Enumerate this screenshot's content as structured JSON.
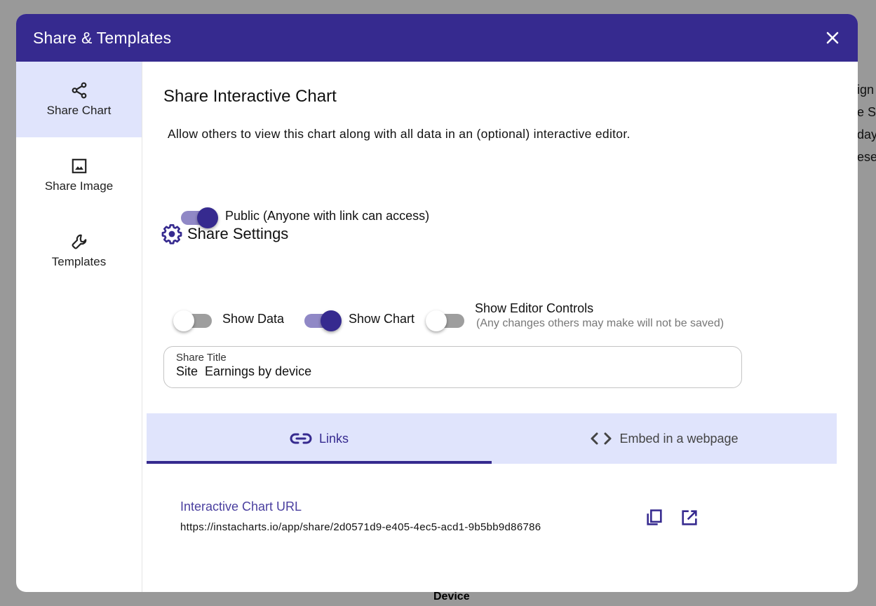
{
  "background": {
    "right_text_fragments": [
      "ign",
      "e S",
      "day",
      "ese"
    ],
    "footer_label": "Device"
  },
  "modal": {
    "title": "Share & Templates",
    "close_icon": "close-icon",
    "colors": {
      "primary": "#362a8f",
      "active_bg": "#e0e4fc",
      "switch_track_on": "#9088c6",
      "switch_track_off": "#9e9e9e"
    }
  },
  "sidebar": {
    "items": [
      {
        "label": "Share Chart",
        "icon": "share-icon",
        "active": true
      },
      {
        "label": "Share Image",
        "icon": "image-icon",
        "active": false
      },
      {
        "label": "Templates",
        "icon": "wrench-icon",
        "active": false
      }
    ]
  },
  "main": {
    "heading": "Share Interactive Chart",
    "description": "Allow others to view this chart along with all data in an (optional) interactive editor.",
    "public_toggle": {
      "label": "Public (Anyone with link can access)",
      "checked": true
    },
    "settings": {
      "heading": "Share Settings",
      "icon": "gear-icon",
      "toggles": [
        {
          "label": "Show Data",
          "checked": false
        },
        {
          "label": "Show Chart",
          "checked": true
        },
        {
          "label": "Show Editor Controls",
          "sublabel": "(Any changes others may make will not be saved)",
          "checked": false
        }
      ]
    },
    "share_title": {
      "label": "Share Title",
      "value": "Site  Earnings by device"
    },
    "tabs": [
      {
        "label": "Links",
        "icon": "link-icon",
        "active": true
      },
      {
        "label": "Embed in a webpage",
        "icon": "code-icon",
        "active": false
      }
    ],
    "links": {
      "label": "Interactive Chart URL",
      "url": "https://instacharts.io/app/share/2d0571d9-e405-4ec5-acd1-9b5bb9d86786",
      "copy_icon": "copy-icon",
      "open_icon": "open-in-new-icon"
    }
  }
}
